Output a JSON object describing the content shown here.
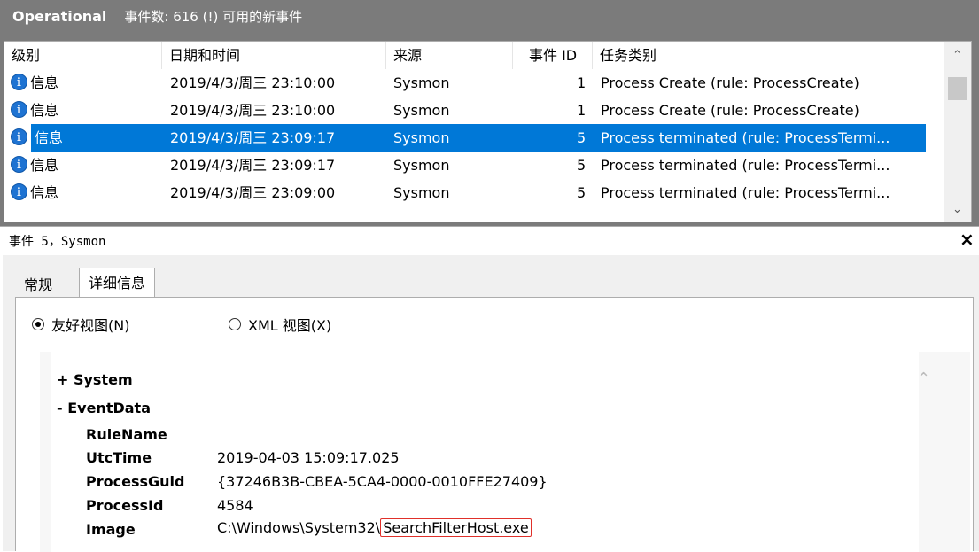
{
  "header": {
    "title": "Operational",
    "count": "事件数: 616 (!) 可用的新事件"
  },
  "columns": [
    "级别",
    "日期和时间",
    "来源",
    "事件 ID",
    "任务类别"
  ],
  "rows": [
    {
      "level": "信息",
      "datetime": "2019/4/3/周三 23:10:00",
      "source": "Sysmon",
      "id": "1",
      "task": "Process Create (rule: ProcessCreate)",
      "selected": false
    },
    {
      "level": "信息",
      "datetime": "2019/4/3/周三 23:10:00",
      "source": "Sysmon",
      "id": "1",
      "task": "Process Create (rule: ProcessCreate)",
      "selected": false
    },
    {
      "level": "信息",
      "datetime": "2019/4/3/周三 23:09:17",
      "source": "Sysmon",
      "id": "5",
      "task": "Process terminated (rule: ProcessTermi...",
      "selected": true
    },
    {
      "level": "信息",
      "datetime": "2019/4/3/周三 23:09:17",
      "source": "Sysmon",
      "id": "5",
      "task": "Process terminated (rule: ProcessTermi...",
      "selected": false
    },
    {
      "level": "信息",
      "datetime": "2019/4/3/周三 23:09:00",
      "source": "Sysmon",
      "id": "5",
      "task": "Process terminated (rule: ProcessTermi...",
      "selected": false
    }
  ],
  "detail": {
    "title": "事件 5，Sysmon",
    "close": "×",
    "tabs": [
      "常规",
      "详细信息"
    ],
    "active_tab": "详细信息",
    "radio_friendly": "友好视图(N)",
    "radio_xml": "XML 视图(X)",
    "tree": {
      "system": "+ System",
      "eventdata": "- EventData",
      "fields": [
        {
          "key": "RuleName",
          "value": ""
        },
        {
          "key": "UtcTime",
          "value": "2019-04-03 15:09:17.025"
        },
        {
          "key": "ProcessGuid",
          "value": "{37246B3B-CBEA-5CA4-0000-0010FFE27409}"
        },
        {
          "key": "ProcessId",
          "value": "4584"
        },
        {
          "key": "Image",
          "value_prefix": "C:\\Windows\\System32\\",
          "value_highlight": "SearchFilterHost.exe"
        }
      ]
    }
  },
  "colors": {
    "selected": "#0078d7",
    "header_bg": "#7b7b7b",
    "highlight_box": "#e0302a",
    "info_icon": "#1e73d2"
  }
}
